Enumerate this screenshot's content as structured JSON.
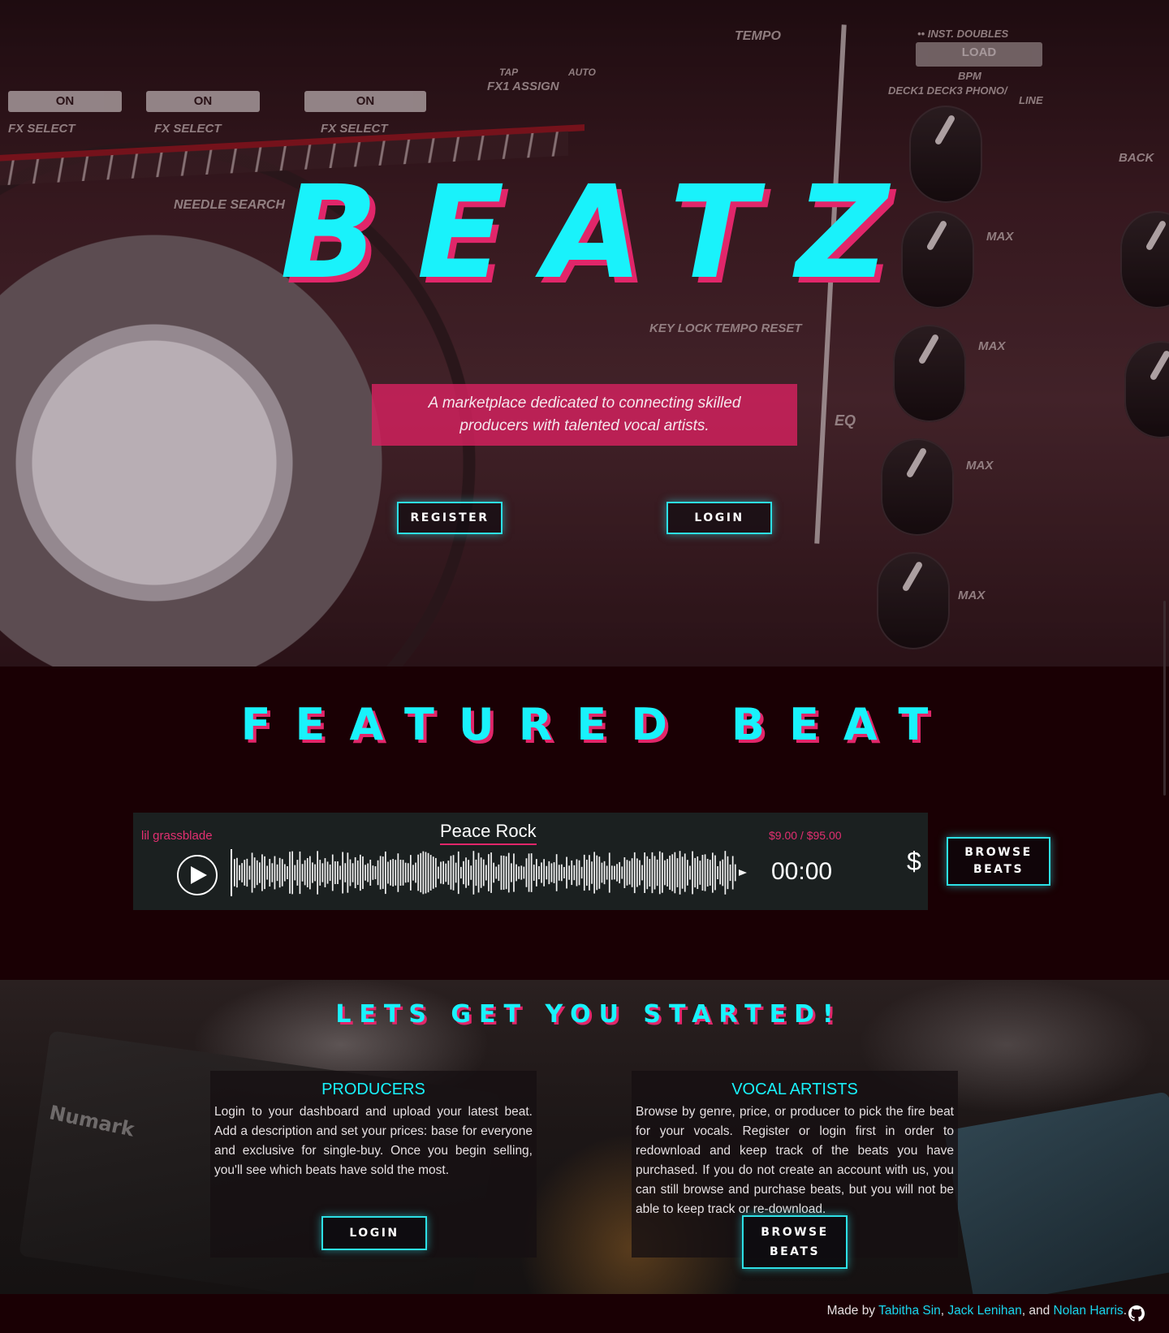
{
  "hero": {
    "title": "BEATZ",
    "tagline": "A marketplace dedicated to connecting skilled producers with talented vocal artists.",
    "register_label": "REGISTER",
    "login_label": "LOGIN",
    "photo_labels": {
      "tempo": "TEMPO",
      "inst_doubles": "•• INST. DOUBLES",
      "load": "LOAD",
      "bpm": "BPM",
      "deck_row": "DECK1  DECK3  PHONO/",
      "line": "LINE",
      "on": "ON",
      "fx_select": "FX SELECT",
      "tap": "TAP",
      "auto": "AUTO",
      "fx1_assign": "FX1 ASSIGN",
      "needle_search": "NEEDLE SEARCH",
      "key_lock": "KEY LOCK",
      "tempo_reset": "TEMPO RESET",
      "back": "BACK",
      "max": "MAX",
      "eq": "EQ"
    }
  },
  "featured": {
    "title": "FEATURED BEAT",
    "player": {
      "producer": "lil grassblade",
      "track_title": "Peace Rock",
      "price": "$9.00 / $95.00",
      "time": "00:00",
      "buy_symbol": "$"
    },
    "browse_label": "BROWSE BEATS"
  },
  "start": {
    "title": "LETS GET YOU STARTED!",
    "brand_text": "Numark",
    "producers": {
      "heading": "PRODUCERS",
      "body": "Login to your dashboard and upload your latest beat. Add a description and set your prices: base for everyone and exclusive for single-buy. Once you begin selling, you'll see which beats have sold the most.",
      "button_label": "LOGIN"
    },
    "artists": {
      "heading": "VOCAL ARTISTS",
      "body": "Browse by genre, price, or producer to pick the fire beat for your vocals. Register or login first in order to redownload and keep track of the beats you have purchased. If you do not create an account with us, you can still browse and purchase beats, but you will not be able to keep track or re-download.",
      "button_label": "BROWSE BEATS"
    }
  },
  "footer": {
    "prefix": "Made by ",
    "author1": "Tabitha Sin",
    "sep1": ", ",
    "author2": "Jack Lenihan",
    "sep2": ", and ",
    "author3": "Nolan Harris",
    "suffix": ".",
    "icon": "github-icon"
  },
  "colors": {
    "accent_cyan": "#19f2fb",
    "accent_pink": "#e1266a",
    "page_bg": "#1a0004"
  }
}
